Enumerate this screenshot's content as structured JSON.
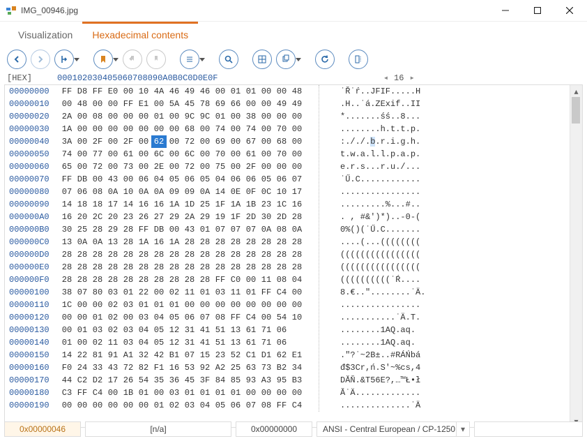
{
  "window": {
    "title": "IMG_00946.jpg"
  },
  "tabs": {
    "visualization": "Visualization",
    "hexadecimal": "Hexadecimal contents"
  },
  "header": {
    "label": "[HEX]",
    "cols": [
      "00",
      "01",
      "02",
      "03",
      "04",
      "05",
      "06",
      "07",
      "08",
      "09",
      "0A",
      "0B",
      "0C",
      "0D",
      "0E",
      "0F"
    ],
    "nav_current": "16"
  },
  "selection": {
    "row": 4,
    "col": 6
  },
  "rows": [
    {
      "offset": "00000000",
      "hex": [
        "FF",
        "D8",
        "FF",
        "E0",
        "00",
        "10",
        "4A",
        "46",
        "49",
        "46",
        "00",
        "01",
        "01",
        "00",
        "00",
        "48"
      ],
      "ascii": "˙Ř˙ŕ..JFIF.....H"
    },
    {
      "offset": "00000010",
      "hex": [
        "00",
        "48",
        "00",
        "00",
        "FF",
        "E1",
        "00",
        "5A",
        "45",
        "78",
        "69",
        "66",
        "00",
        "00",
        "49",
        "49"
      ],
      "ascii": ".H..˙á.ZExif..II"
    },
    {
      "offset": "00000020",
      "hex": [
        "2A",
        "00",
        "08",
        "00",
        "00",
        "00",
        "01",
        "00",
        "9C",
        "9C",
        "01",
        "00",
        "38",
        "00",
        "00",
        "00"
      ],
      "ascii": "*.......śś..8..."
    },
    {
      "offset": "00000030",
      "hex": [
        "1A",
        "00",
        "00",
        "00",
        "00",
        "00",
        "00",
        "00",
        "68",
        "00",
        "74",
        "00",
        "74",
        "00",
        "70",
        "00"
      ],
      "ascii": "........h.t.t.p."
    },
    {
      "offset": "00000040",
      "hex": [
        "3A",
        "00",
        "2F",
        "00",
        "2F",
        "00",
        "62",
        "00",
        "72",
        "00",
        "69",
        "00",
        "67",
        "00",
        "68",
        "00"
      ],
      "ascii": ":././.b.r.i.g.h."
    },
    {
      "offset": "00000050",
      "hex": [
        "74",
        "00",
        "77",
        "00",
        "61",
        "00",
        "6C",
        "00",
        "6C",
        "00",
        "70",
        "00",
        "61",
        "00",
        "70",
        "00"
      ],
      "ascii": "t.w.a.l.l.p.a.p."
    },
    {
      "offset": "00000060",
      "hex": [
        "65",
        "00",
        "72",
        "00",
        "73",
        "00",
        "2E",
        "00",
        "72",
        "00",
        "75",
        "00",
        "2F",
        "00",
        "00",
        "00"
      ],
      "ascii": "e.r.s...r.u./..."
    },
    {
      "offset": "00000070",
      "hex": [
        "FF",
        "DB",
        "00",
        "43",
        "00",
        "06",
        "04",
        "05",
        "06",
        "05",
        "04",
        "06",
        "06",
        "05",
        "06",
        "07"
      ],
      "ascii": "˙Ű.C............"
    },
    {
      "offset": "00000080",
      "hex": [
        "07",
        "06",
        "08",
        "0A",
        "10",
        "0A",
        "0A",
        "09",
        "09",
        "0A",
        "14",
        "0E",
        "0F",
        "0C",
        "10",
        "17"
      ],
      "ascii": "................"
    },
    {
      "offset": "00000090",
      "hex": [
        "14",
        "18",
        "18",
        "17",
        "14",
        "16",
        "16",
        "1A",
        "1D",
        "25",
        "1F",
        "1A",
        "1B",
        "23",
        "1C",
        "16"
      ],
      "ascii": ".........%...#.."
    },
    {
      "offset": "000000A0",
      "hex": [
        "16",
        "20",
        "2C",
        "20",
        "23",
        "26",
        "27",
        "29",
        "2A",
        "29",
        "19",
        "1F",
        "2D",
        "30",
        "2D",
        "28"
      ],
      "ascii": ". , #&')*)..-0-("
    },
    {
      "offset": "000000B0",
      "hex": [
        "30",
        "25",
        "28",
        "29",
        "28",
        "FF",
        "DB",
        "00",
        "43",
        "01",
        "07",
        "07",
        "07",
        "0A",
        "08",
        "0A"
      ],
      "ascii": "0%()(˙Ű.C......."
    },
    {
      "offset": "000000C0",
      "hex": [
        "13",
        "0A",
        "0A",
        "13",
        "28",
        "1A",
        "16",
        "1A",
        "28",
        "28",
        "28",
        "28",
        "28",
        "28",
        "28",
        "28"
      ],
      "ascii": "....(...(((((((("
    },
    {
      "offset": "000000D0",
      "hex": [
        "28",
        "28",
        "28",
        "28",
        "28",
        "28",
        "28",
        "28",
        "28",
        "28",
        "28",
        "28",
        "28",
        "28",
        "28",
        "28"
      ],
      "ascii": "(((((((((((((((("
    },
    {
      "offset": "000000E0",
      "hex": [
        "28",
        "28",
        "28",
        "28",
        "28",
        "28",
        "28",
        "28",
        "28",
        "28",
        "28",
        "28",
        "28",
        "28",
        "28",
        "28"
      ],
      "ascii": "(((((((((((((((("
    },
    {
      "offset": "000000F0",
      "hex": [
        "28",
        "28",
        "28",
        "28",
        "28",
        "28",
        "28",
        "28",
        "28",
        "28",
        "FF",
        "C0",
        "00",
        "11",
        "08",
        "04"
      ],
      "ascii": "((((((((((˙Ŕ...."
    },
    {
      "offset": "00000100",
      "hex": [
        "38",
        "07",
        "80",
        "03",
        "01",
        "22",
        "00",
        "02",
        "11",
        "01",
        "03",
        "11",
        "01",
        "FF",
        "C4",
        "00"
      ],
      "ascii": "8.€..\"........˙Ä."
    },
    {
      "offset": "00000110",
      "hex": [
        "1C",
        "00",
        "00",
        "02",
        "03",
        "01",
        "01",
        "01",
        "00",
        "00",
        "00",
        "00",
        "00",
        "00",
        "00",
        "00"
      ],
      "ascii": "................"
    },
    {
      "offset": "00000120",
      "hex": [
        "00",
        "00",
        "01",
        "02",
        "00",
        "03",
        "04",
        "05",
        "06",
        "07",
        "08",
        "FF",
        "C4",
        "00",
        "54",
        "10"
      ],
      "ascii": "...........˙Ä.T."
    },
    {
      "offset": "00000130",
      "hex": [
        "00",
        "01",
        "03",
        "02",
        "03",
        "04",
        "05",
        "12",
        "31",
        "41",
        "51",
        "13",
        "61",
        "71",
        "06"
      ],
      "ascii": "........1AQ.aq."
    },
    {
      "offset": "00000140",
      "hex": [
        "01",
        "00",
        "02",
        "11",
        "03",
        "04",
        "05",
        "12",
        "31",
        "41",
        "51",
        "13",
        "61",
        "71",
        "06"
      ],
      "ascii": "........1AQ.aq."
    },
    {
      "offset": "00000150",
      "hex": [
        "14",
        "22",
        "81",
        "91",
        "A1",
        "32",
        "42",
        "B1",
        "07",
        "15",
        "23",
        "52",
        "C1",
        "D1",
        "62",
        "E1"
      ],
      "ascii": ".\"?˙~2B±..#RÁŃbá"
    },
    {
      "offset": "00000160",
      "hex": [
        "F0",
        "24",
        "33",
        "43",
        "72",
        "82",
        "F1",
        "16",
        "53",
        "92",
        "A2",
        "25",
        "63",
        "73",
        "B2",
        "34"
      ],
      "ascii": "đ$3Cr,ń.S'~%cs,4"
    },
    {
      "offset": "00000170",
      "hex": [
        "44",
        "C2",
        "D2",
        "17",
        "26",
        "54",
        "35",
        "36",
        "45",
        "3F",
        "84",
        "85",
        "93",
        "A3",
        "95",
        "B3"
      ],
      "ascii": "DĂŇ.&T56E?,…™Ł•ł"
    },
    {
      "offset": "00000180",
      "hex": [
        "C3",
        "FF",
        "C4",
        "00",
        "1B",
        "01",
        "00",
        "03",
        "01",
        "01",
        "01",
        "01",
        "00",
        "00",
        "00",
        "00"
      ],
      "ascii": "Ă˙Ä............."
    },
    {
      "offset": "00000190",
      "hex": [
        "00",
        "00",
        "00",
        "00",
        "00",
        "00",
        "01",
        "02",
        "03",
        "04",
        "05",
        "06",
        "07",
        "08",
        "FF",
        "C4"
      ],
      "ascii": "..............˙Ä"
    }
  ],
  "status": {
    "offset": "0x00000046",
    "na": "[n/a]",
    "addr2": "0x00000000",
    "encoding": "ANSI - Central European / CP-1250"
  }
}
